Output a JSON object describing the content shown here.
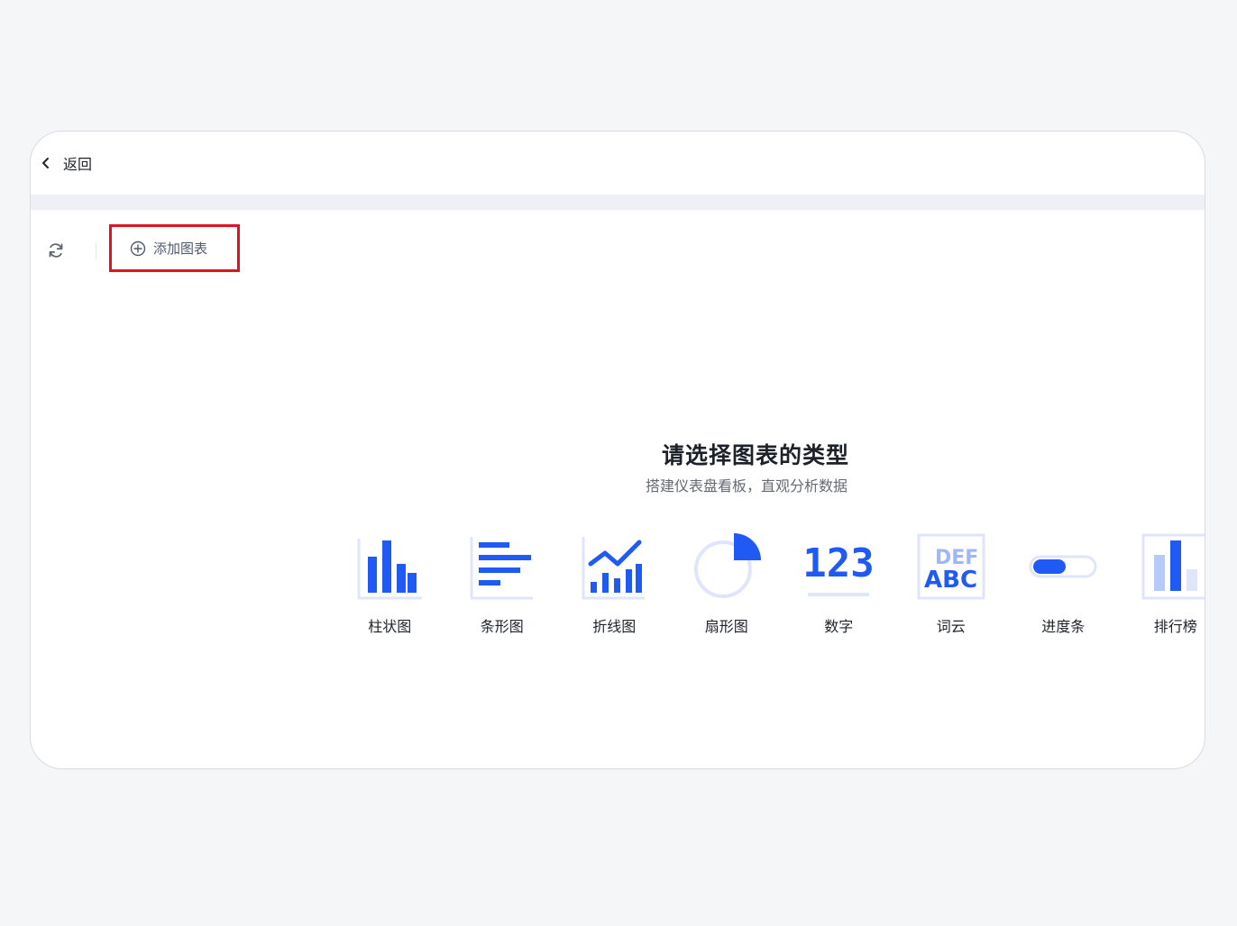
{
  "topbar": {
    "back_label": "返回",
    "back_icon": "chevron-left-icon"
  },
  "toolbar": {
    "refresh_icon": "refresh-icon",
    "add_chart_label": "添加图表",
    "add_icon": "plus-circle-icon"
  },
  "empty_state": {
    "title": "请选择图表的类型",
    "subtitle": "搭建仪表盘看板，直观分析数据"
  },
  "chart_types": [
    {
      "label": "柱状图",
      "icon": "bar-chart-icon"
    },
    {
      "label": "条形图",
      "icon": "horizontal-bar-chart-icon"
    },
    {
      "label": "折线图",
      "icon": "line-chart-icon"
    },
    {
      "label": "扇形图",
      "icon": "pie-chart-icon"
    },
    {
      "label": "数字",
      "icon": "number-icon",
      "icon_text": "123"
    },
    {
      "label": "词云",
      "icon": "word-cloud-icon",
      "icon_text_top": "DEF",
      "icon_text_bottom": "ABC"
    },
    {
      "label": "进度条",
      "icon": "progress-bar-icon"
    },
    {
      "label": "排行榜",
      "icon": "ranking-icon"
    }
  ],
  "colors": {
    "accent": "#1f5af5",
    "accent_light": "#dfe6fb",
    "highlight_border": "#e0141e"
  }
}
